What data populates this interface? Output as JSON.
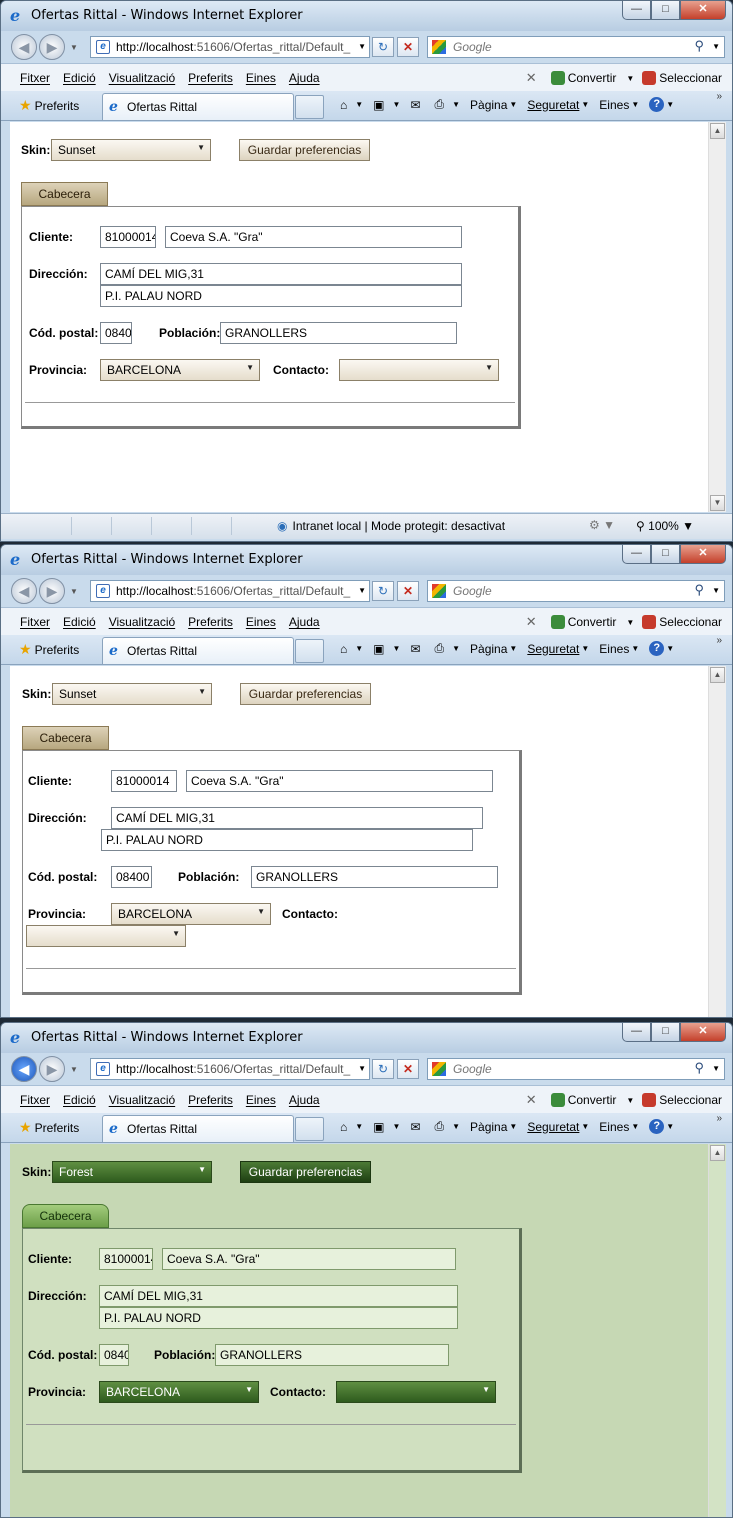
{
  "browser": {
    "window_title": "Ofertas Rittal - Windows Internet Explorer",
    "url_host": "http://localhost",
    "url_rest": ":51606/Ofertas_rittal/Default_",
    "search_placeholder": "Google",
    "menu": [
      "Fitxer",
      "Edició",
      "Visualització",
      "Preferits",
      "Eines",
      "Ajuda"
    ],
    "convert_label": "Convertir",
    "select_label": "Seleccionar",
    "favorites_label": "Preferits",
    "tab_title": "Ofertas Rittal",
    "cmd_page": "Pàgina",
    "cmd_security": "Seguretat",
    "cmd_tools": "Eines",
    "status_zone": "Intranet local | Mode protegit: desactivat",
    "zoom": "100%"
  },
  "form": {
    "skin_label": "Skin:",
    "save_button": "Guardar preferencias",
    "tab_label": "Cabecera",
    "cliente_label": "Cliente:",
    "cliente_code": "81000014",
    "cliente_name": "Coeva S.A. \"Gra\"",
    "direccion_label": "Dirección:",
    "direccion_1": "CAMÍ DEL MIG,31",
    "direccion_2": "P.I. PALAU NORD",
    "cp_label": "Cód. postal:",
    "cp_value": "08400",
    "poblacion_label": "Población:",
    "poblacion_value": "GRANOLLERS",
    "provincia_label": "Provincia:",
    "provincia_value": "BARCELONA",
    "contacto_label": "Contacto:",
    "contacto_value": ""
  },
  "windows": [
    {
      "skin": "Sunset"
    },
    {
      "skin": "Sunset"
    },
    {
      "skin": "Forest"
    }
  ]
}
